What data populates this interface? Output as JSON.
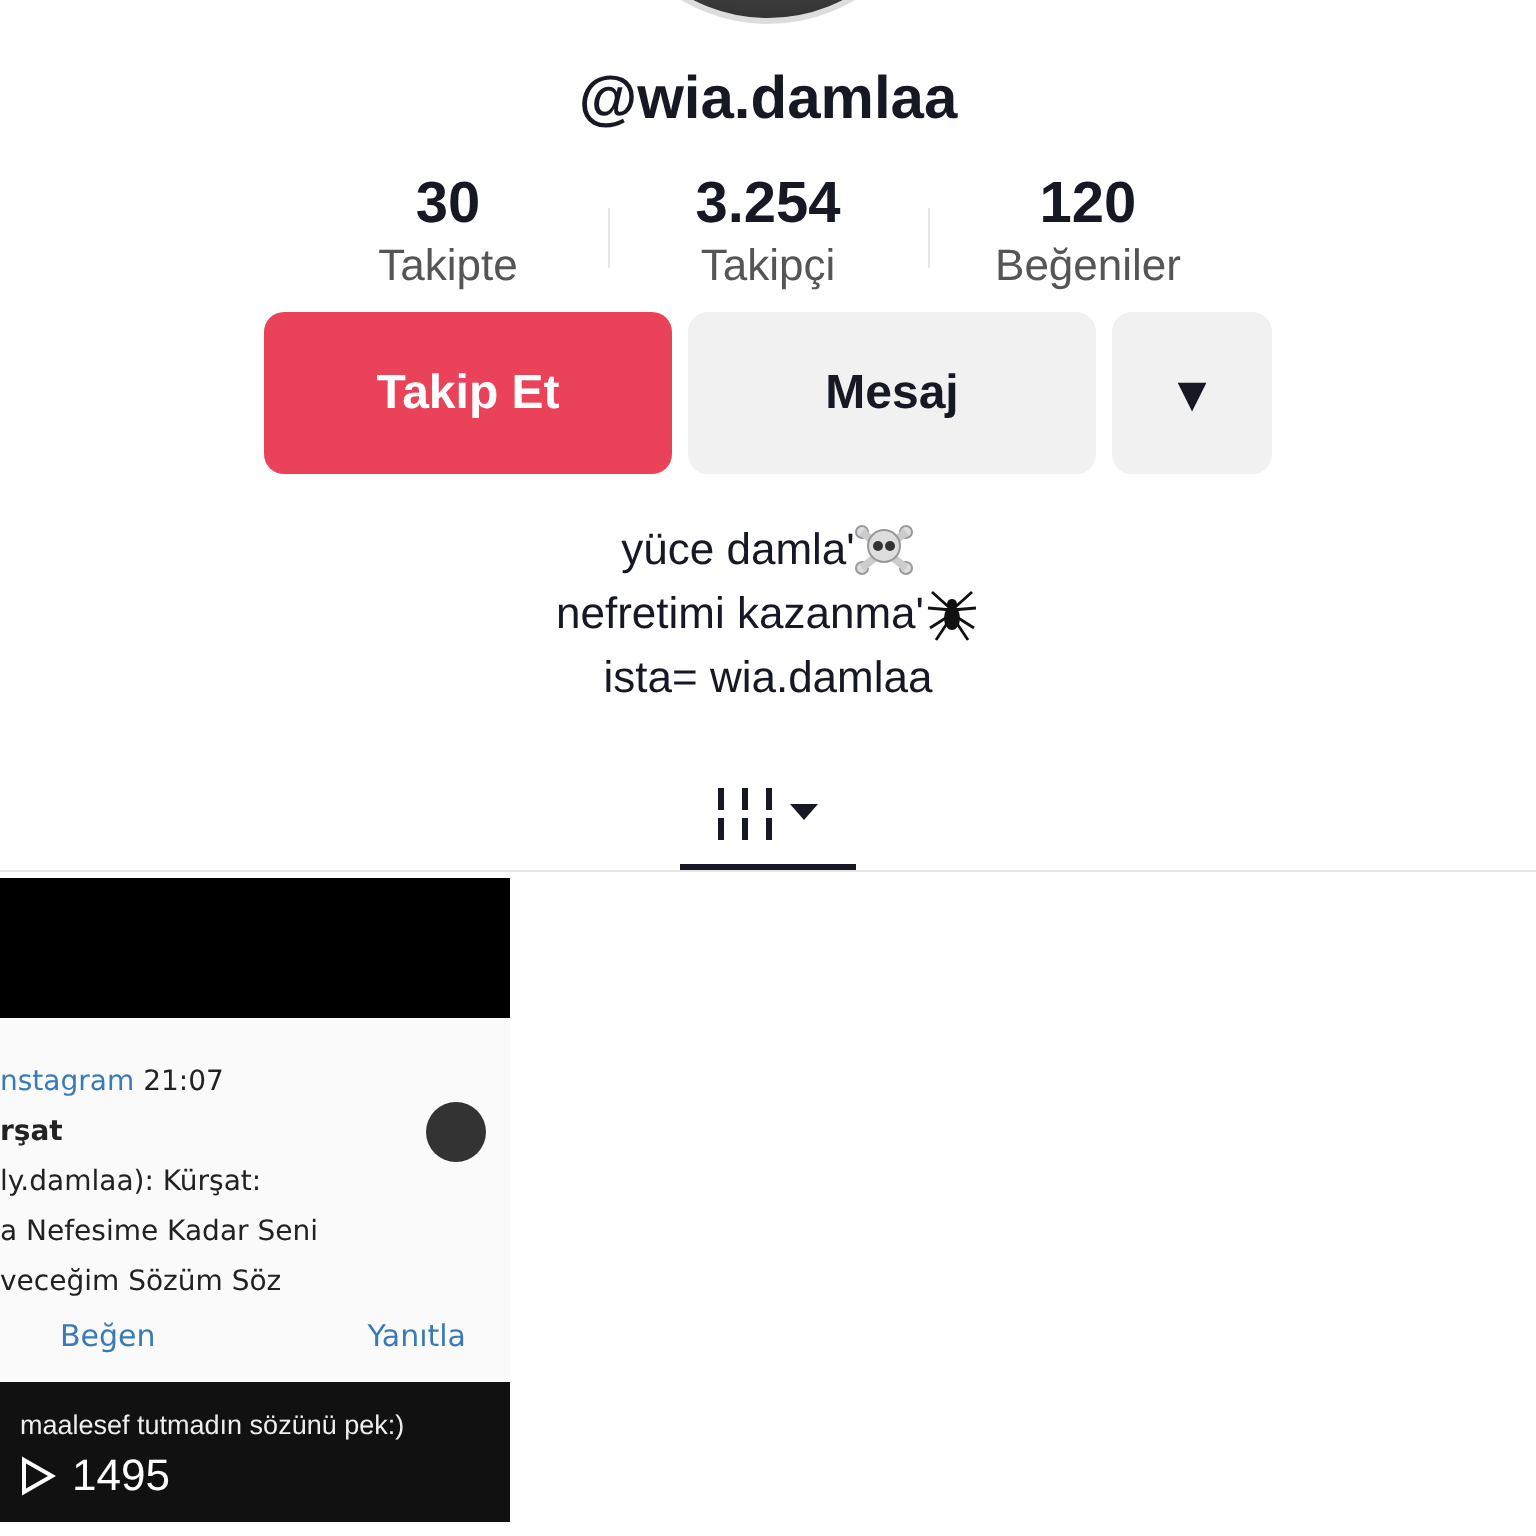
{
  "profile": {
    "username": "@wia.damlaa"
  },
  "stats": [
    {
      "value": "30",
      "label": "Takipte"
    },
    {
      "value": "3.254",
      "label": "Takipçi"
    },
    {
      "value": "120",
      "label": "Beğeniler"
    }
  ],
  "buttons": [
    {
      "kind": "primary",
      "label": "Takip Et"
    },
    {
      "kind": "secondary",
      "label": "Mesaj"
    },
    {
      "kind": "dropdown",
      "label": "▾"
    }
  ],
  "bio": [
    "yüce damla'",
    "nefretimi kazanma'",
    "ista= wia.damlaa"
  ],
  "tabs": [
    {
      "kind": "grid",
      "selected": true
    }
  ],
  "videos": [
    {
      "notification": {
        "app": "nstagram",
        "time": "21:07",
        "sender": "rşat",
        "lines": [
          "ly.damlaa): Kürşat:",
          "a Nefesime Kadar Seni",
          "veceğim Sözüm Söz"
        ],
        "actions": [
          "Beğen",
          "Yanıtla"
        ]
      },
      "caption": "maalesef tutmadın sözünü pek:)",
      "views": "1495"
    }
  ]
}
